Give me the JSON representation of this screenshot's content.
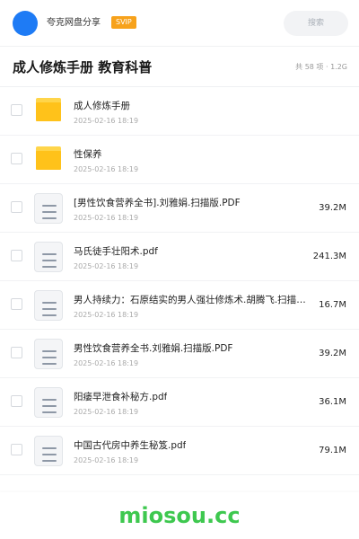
{
  "header": {
    "app_name": "夸克网盘分享",
    "badge": "SVIP",
    "search_placeholder": "搜索"
  },
  "folder": {
    "title": "成人修炼手册 教育科普",
    "summary": "共 58 项 · 1.2G"
  },
  "files": [
    {
      "type": "folder",
      "name": "成人修炼手册",
      "date": "2025-02-16 18:19",
      "size": ""
    },
    {
      "type": "folder",
      "name": "性保养",
      "date": "2025-02-16 18:19",
      "size": ""
    },
    {
      "type": "doc",
      "name": "[男性饮食营养全书].刘雅娟.扫描版.PDF",
      "date": "2025-02-16 18:19",
      "size": "39.2M"
    },
    {
      "type": "doc",
      "name": "马氏徒手壮阳术.pdf",
      "date": "2025-02-16 18:19",
      "size": "241.3M"
    },
    {
      "type": "doc",
      "name": "男人持续力：石原结实的男人强壮修炼术.胡腾飞.扫描版.pdf",
      "date": "2025-02-16 18:19",
      "size": "16.7M"
    },
    {
      "type": "doc",
      "name": "男性饮食营养全书.刘雅娟.扫描版.PDF",
      "date": "2025-02-16 18:19",
      "size": "39.2M"
    },
    {
      "type": "doc",
      "name": "阳痿早泄食补秘方.pdf",
      "date": "2025-02-16 18:19",
      "size": "36.1M"
    },
    {
      "type": "doc",
      "name": "中国古代房中养生秘笈.pdf",
      "date": "2025-02-16 18:19",
      "size": "79.1M"
    }
  ],
  "watermark": "miosou.cc",
  "colors": {
    "avatar": "#1e7bf5",
    "svip_badge": "#f7a21b",
    "folder": "#ffc21a",
    "watermark": "#3ec84f"
  },
  "icons": {
    "folder": "folder-icon",
    "doc": "document-icon"
  }
}
